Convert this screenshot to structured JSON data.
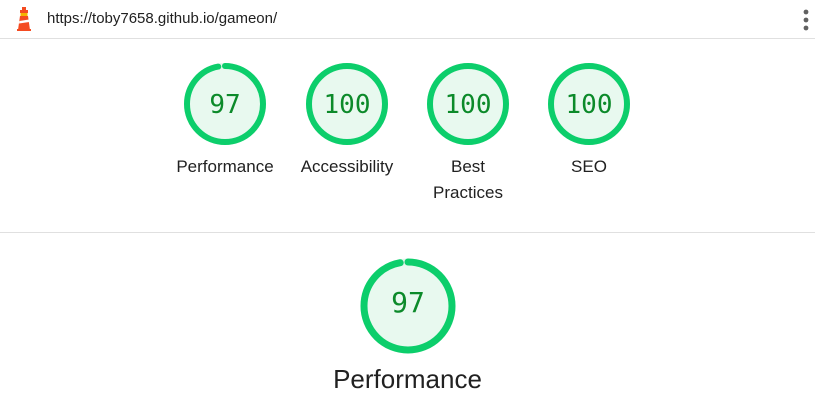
{
  "browser": {
    "url": "https://toby7658.github.io/gameon/"
  },
  "colors": {
    "pass_ring": "#0cce6b",
    "pass_fill": "#e8f9ef",
    "pass_text": "#0c8a2a",
    "gap": "#e0f5ea"
  },
  "gauges": [
    {
      "score": "97",
      "fraction": 0.97,
      "label": "Performance"
    },
    {
      "score": "100",
      "fraction": 1.0,
      "label": "Accessibility"
    },
    {
      "score": "100",
      "fraction": 1.0,
      "label": "Best Practices"
    },
    {
      "score": "100",
      "fraction": 1.0,
      "label": "SEO"
    }
  ],
  "detail": {
    "score": "97",
    "fraction": 0.97,
    "title": "Performance"
  },
  "icons": {
    "app": "lighthouse-icon",
    "menu": "kebab-menu-icon"
  }
}
